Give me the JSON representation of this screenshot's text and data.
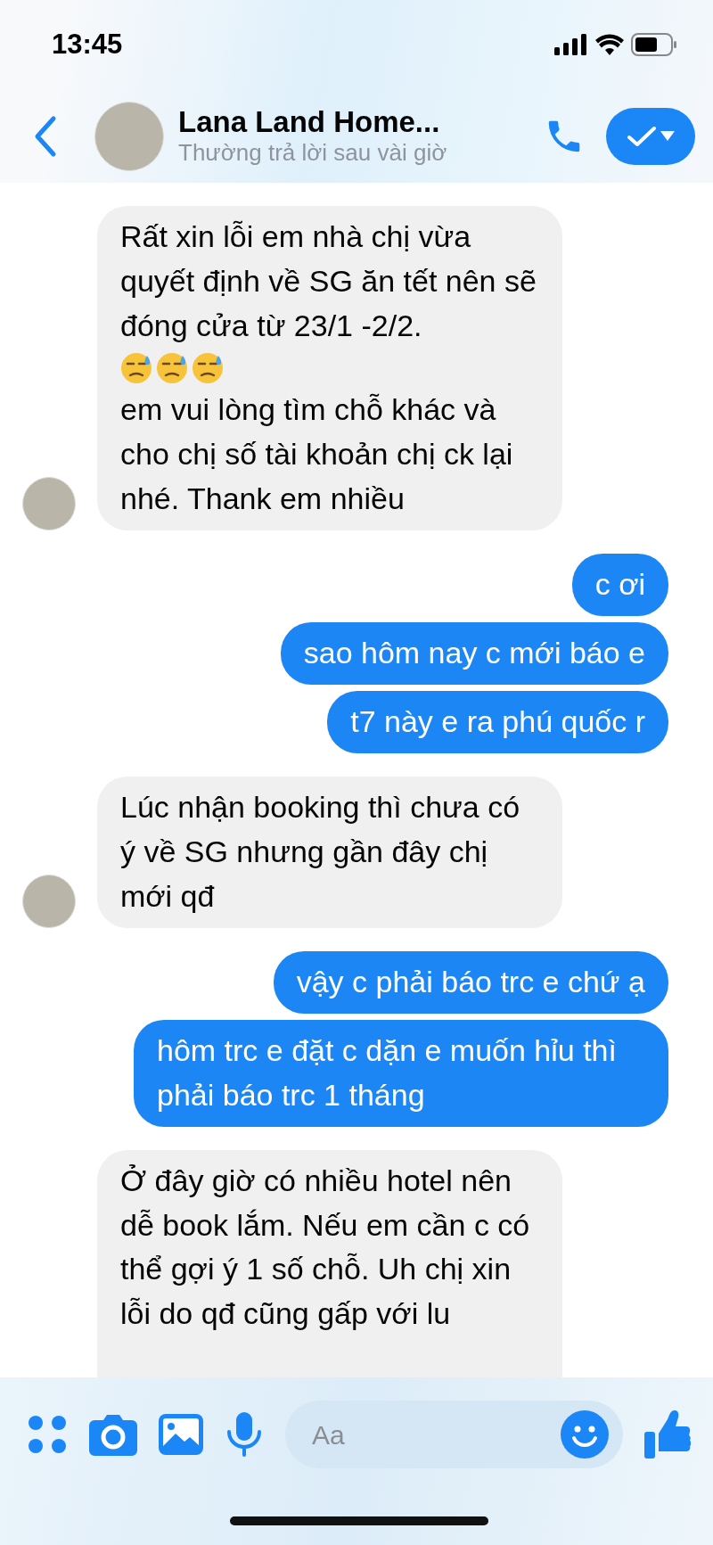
{
  "status_bar": {
    "time": "13:45"
  },
  "header": {
    "title": "Lana Land Home...",
    "subtitle": "Thường trả lời sau vài giờ"
  },
  "messages": [
    {
      "outgoing": false,
      "avatar": true,
      "parts": [
        {
          "kind": "text",
          "text": "Rất xin lỗi em nhà chị vừa quyết định về SG ăn tết nên sẽ đóng cửa từ 23/1 -2/2."
        },
        {
          "kind": "emoji"
        },
        {
          "kind": "emoji"
        },
        {
          "kind": "emoji"
        },
        {
          "kind": "text",
          "text": "em vui lòng tìm chỗ khác và cho chị số tài khoản chị ck lại nhé. Thank em nhiều"
        }
      ]
    },
    {
      "outgoing": true,
      "avatar": false,
      "parts": [
        {
          "kind": "text",
          "text": "c ơi"
        }
      ]
    },
    {
      "outgoing": true,
      "avatar": false,
      "parts": [
        {
          "kind": "text",
          "text": "sao hôm nay c mới báo e"
        }
      ]
    },
    {
      "outgoing": true,
      "avatar": false,
      "parts": [
        {
          "kind": "text",
          "text": "t7 này e ra phú quốc r"
        }
      ]
    },
    {
      "outgoing": false,
      "avatar": true,
      "parts": [
        {
          "kind": "text",
          "text": "Lúc nhận booking thì chưa có ý về SG nhưng gần đây chị mới qđ"
        }
      ]
    },
    {
      "outgoing": true,
      "avatar": false,
      "parts": [
        {
          "kind": "text",
          "text": "vậy c phải báo trc e chứ ạ"
        }
      ]
    },
    {
      "outgoing": true,
      "avatar": false,
      "parts": [
        {
          "kind": "text",
          "text": "hôm trc e đặt c dặn e muốn hỉu thì phải báo trc 1 tháng"
        }
      ]
    },
    {
      "outgoing": false,
      "avatar": false,
      "parts": [
        {
          "kind": "text",
          "text": "Ở đây giờ có nhiều hotel nên dễ book lắm. Nếu em cần c có thể gợi ý 1 số chỗ. Uh chị xin lỗi do qđ cũng gấp với lu"
        }
      ]
    }
  ],
  "composer": {
    "placeholder": "Aa"
  }
}
